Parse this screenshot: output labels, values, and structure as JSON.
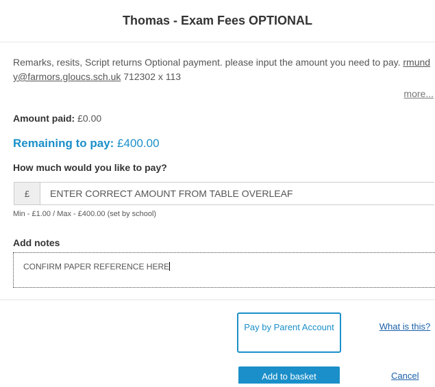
{
  "modal": {
    "title": "Thomas - Exam Fees OPTIONAL"
  },
  "description": {
    "text": "Remarks, resits, Script returns Optional payment. please input the amount you need to pay. ",
    "email": "rmundy@farmors.gloucs.sch.uk",
    "phone": " 712302 x 113",
    "more_label": "more..."
  },
  "payment": {
    "amount_paid_label": "Amount paid:",
    "amount_paid_value": " £0.00",
    "remaining_label": "Remaining to pay:",
    "remaining_value": " £400.00",
    "question": "How much would you like to pay?",
    "currency_symbol": "£",
    "amount_placeholder": "ENTER CORRECT AMOUNT FROM TABLE OVERLEAF",
    "limits": "Min - £1.00 / Max - £400.00 (set by school)"
  },
  "notes": {
    "label": "Add notes",
    "value": "CONFIRM PAPER REFERENCE HERE"
  },
  "actions": {
    "pay_parent_account": "Pay by Parent Account",
    "what_is_this": "What is this?",
    "add_to_basket": "Add to basket",
    "cancel": "Cancel"
  },
  "colors": {
    "accent": "#1a8fc9",
    "link": "#1a5fa8"
  }
}
